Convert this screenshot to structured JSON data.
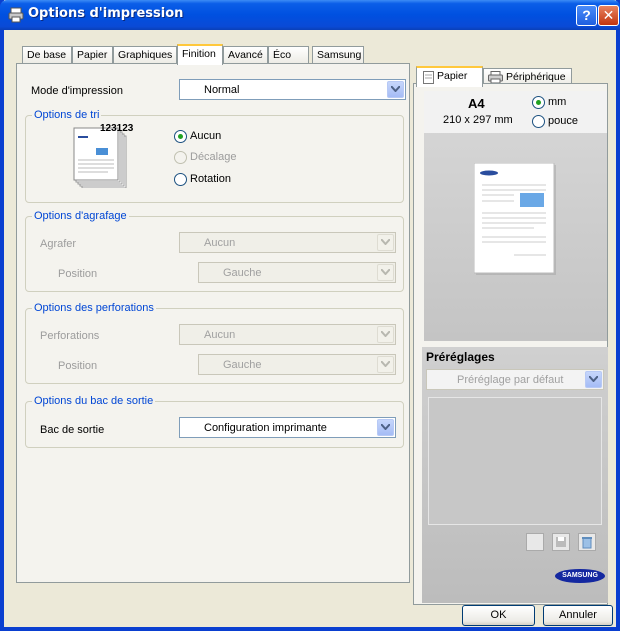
{
  "window": {
    "title": "Options d'impression",
    "help_label": "?",
    "close_label": "✕"
  },
  "tabs": [
    {
      "label": "De base"
    },
    {
      "label": "Papier"
    },
    {
      "label": "Graphiques"
    },
    {
      "label": "Finition",
      "active": true
    },
    {
      "label": "Avancé"
    },
    {
      "label": "Éco"
    },
    {
      "label": "Samsung"
    }
  ],
  "print_mode": {
    "label": "Mode d'impression",
    "value": "Normal"
  },
  "sort_options": {
    "title": "Options de tri",
    "illustration_text": "123123",
    "options": [
      {
        "label": "Aucun",
        "checked": true,
        "disabled": false
      },
      {
        "label": "Décalage",
        "checked": false,
        "disabled": true
      },
      {
        "label": "Rotation",
        "checked": false,
        "disabled": false
      }
    ]
  },
  "stapling": {
    "title": "Options d'agrafage",
    "staple_label": "Agrafer",
    "staple_value": "Aucun",
    "position_label": "Position",
    "position_value": "Gauche"
  },
  "punching": {
    "title": "Options des perforations",
    "punch_label": "Perforations",
    "punch_value": "Aucun",
    "position_label": "Position",
    "position_value": "Gauche"
  },
  "output_tray": {
    "title": "Options du bac de sortie",
    "label": "Bac de sortie",
    "value": "Configuration imprimante"
  },
  "preview": {
    "tabs": [
      {
        "label": "Papier",
        "icon": "paper-icon",
        "active": true
      },
      {
        "label": "Périphérique",
        "icon": "printer-icon",
        "active": false
      }
    ],
    "paper_size": "A4",
    "paper_dimensions": "210 x 297 mm",
    "units": [
      {
        "label": "mm",
        "checked": true
      },
      {
        "label": "pouce",
        "checked": false
      }
    ]
  },
  "presets": {
    "title": "Préréglages",
    "selected": "Préréglage par défaut",
    "logo": "SAMSUNG"
  },
  "buttons": {
    "ok": "OK",
    "cancel": "Annuler"
  },
  "colors": {
    "title_bar": "#0050e0",
    "group_title": "#0046d5",
    "radio_checked": "#21a121",
    "samsung_blue": "#1428a0"
  }
}
